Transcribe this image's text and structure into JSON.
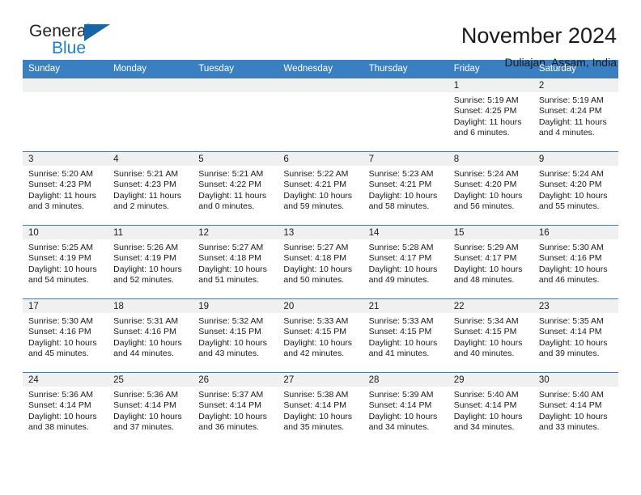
{
  "brand": {
    "name_part1": "General",
    "name_part2": "Blue"
  },
  "header": {
    "title": "November 2024",
    "subtitle": "Duliajan, Assam, India"
  },
  "colors": {
    "header_blue": "#3a7fc1",
    "logo_blue": "#1e7fc4",
    "date_band": "#f0f0f0"
  },
  "weekday_headers": [
    "Sunday",
    "Monday",
    "Tuesday",
    "Wednesday",
    "Thursday",
    "Friday",
    "Saturday"
  ],
  "labels": {
    "sunrise_prefix": "Sunrise:",
    "sunset_prefix": "Sunset:",
    "daylight_prefix": "Daylight:"
  },
  "weeks": [
    [
      {
        "empty": true
      },
      {
        "empty": true
      },
      {
        "empty": true
      },
      {
        "empty": true
      },
      {
        "empty": true
      },
      {
        "day": "1",
        "sunrise": "Sunrise: 5:19 AM",
        "sunset": "Sunset: 4:25 PM",
        "daylight_line1": "Daylight: 11 hours",
        "daylight_line2": "and 6 minutes."
      },
      {
        "day": "2",
        "sunrise": "Sunrise: 5:19 AM",
        "sunset": "Sunset: 4:24 PM",
        "daylight_line1": "Daylight: 11 hours",
        "daylight_line2": "and 4 minutes."
      }
    ],
    [
      {
        "day": "3",
        "sunrise": "Sunrise: 5:20 AM",
        "sunset": "Sunset: 4:23 PM",
        "daylight_line1": "Daylight: 11 hours",
        "daylight_line2": "and 3 minutes."
      },
      {
        "day": "4",
        "sunrise": "Sunrise: 5:21 AM",
        "sunset": "Sunset: 4:23 PM",
        "daylight_line1": "Daylight: 11 hours",
        "daylight_line2": "and 2 minutes."
      },
      {
        "day": "5",
        "sunrise": "Sunrise: 5:21 AM",
        "sunset": "Sunset: 4:22 PM",
        "daylight_line1": "Daylight: 11 hours",
        "daylight_line2": "and 0 minutes."
      },
      {
        "day": "6",
        "sunrise": "Sunrise: 5:22 AM",
        "sunset": "Sunset: 4:21 PM",
        "daylight_line1": "Daylight: 10 hours",
        "daylight_line2": "and 59 minutes."
      },
      {
        "day": "7",
        "sunrise": "Sunrise: 5:23 AM",
        "sunset": "Sunset: 4:21 PM",
        "daylight_line1": "Daylight: 10 hours",
        "daylight_line2": "and 58 minutes."
      },
      {
        "day": "8",
        "sunrise": "Sunrise: 5:24 AM",
        "sunset": "Sunset: 4:20 PM",
        "daylight_line1": "Daylight: 10 hours",
        "daylight_line2": "and 56 minutes."
      },
      {
        "day": "9",
        "sunrise": "Sunrise: 5:24 AM",
        "sunset": "Sunset: 4:20 PM",
        "daylight_line1": "Daylight: 10 hours",
        "daylight_line2": "and 55 minutes."
      }
    ],
    [
      {
        "day": "10",
        "sunrise": "Sunrise: 5:25 AM",
        "sunset": "Sunset: 4:19 PM",
        "daylight_line1": "Daylight: 10 hours",
        "daylight_line2": "and 54 minutes."
      },
      {
        "day": "11",
        "sunrise": "Sunrise: 5:26 AM",
        "sunset": "Sunset: 4:19 PM",
        "daylight_line1": "Daylight: 10 hours",
        "daylight_line2": "and 52 minutes."
      },
      {
        "day": "12",
        "sunrise": "Sunrise: 5:27 AM",
        "sunset": "Sunset: 4:18 PM",
        "daylight_line1": "Daylight: 10 hours",
        "daylight_line2": "and 51 minutes."
      },
      {
        "day": "13",
        "sunrise": "Sunrise: 5:27 AM",
        "sunset": "Sunset: 4:18 PM",
        "daylight_line1": "Daylight: 10 hours",
        "daylight_line2": "and 50 minutes."
      },
      {
        "day": "14",
        "sunrise": "Sunrise: 5:28 AM",
        "sunset": "Sunset: 4:17 PM",
        "daylight_line1": "Daylight: 10 hours",
        "daylight_line2": "and 49 minutes."
      },
      {
        "day": "15",
        "sunrise": "Sunrise: 5:29 AM",
        "sunset": "Sunset: 4:17 PM",
        "daylight_line1": "Daylight: 10 hours",
        "daylight_line2": "and 48 minutes."
      },
      {
        "day": "16",
        "sunrise": "Sunrise: 5:30 AM",
        "sunset": "Sunset: 4:16 PM",
        "daylight_line1": "Daylight: 10 hours",
        "daylight_line2": "and 46 minutes."
      }
    ],
    [
      {
        "day": "17",
        "sunrise": "Sunrise: 5:30 AM",
        "sunset": "Sunset: 4:16 PM",
        "daylight_line1": "Daylight: 10 hours",
        "daylight_line2": "and 45 minutes."
      },
      {
        "day": "18",
        "sunrise": "Sunrise: 5:31 AM",
        "sunset": "Sunset: 4:16 PM",
        "daylight_line1": "Daylight: 10 hours",
        "daylight_line2": "and 44 minutes."
      },
      {
        "day": "19",
        "sunrise": "Sunrise: 5:32 AM",
        "sunset": "Sunset: 4:15 PM",
        "daylight_line1": "Daylight: 10 hours",
        "daylight_line2": "and 43 minutes."
      },
      {
        "day": "20",
        "sunrise": "Sunrise: 5:33 AM",
        "sunset": "Sunset: 4:15 PM",
        "daylight_line1": "Daylight: 10 hours",
        "daylight_line2": "and 42 minutes."
      },
      {
        "day": "21",
        "sunrise": "Sunrise: 5:33 AM",
        "sunset": "Sunset: 4:15 PM",
        "daylight_line1": "Daylight: 10 hours",
        "daylight_line2": "and 41 minutes."
      },
      {
        "day": "22",
        "sunrise": "Sunrise: 5:34 AM",
        "sunset": "Sunset: 4:15 PM",
        "daylight_line1": "Daylight: 10 hours",
        "daylight_line2": "and 40 minutes."
      },
      {
        "day": "23",
        "sunrise": "Sunrise: 5:35 AM",
        "sunset": "Sunset: 4:14 PM",
        "daylight_line1": "Daylight: 10 hours",
        "daylight_line2": "and 39 minutes."
      }
    ],
    [
      {
        "day": "24",
        "sunrise": "Sunrise: 5:36 AM",
        "sunset": "Sunset: 4:14 PM",
        "daylight_line1": "Daylight: 10 hours",
        "daylight_line2": "and 38 minutes."
      },
      {
        "day": "25",
        "sunrise": "Sunrise: 5:36 AM",
        "sunset": "Sunset: 4:14 PM",
        "daylight_line1": "Daylight: 10 hours",
        "daylight_line2": "and 37 minutes."
      },
      {
        "day": "26",
        "sunrise": "Sunrise: 5:37 AM",
        "sunset": "Sunset: 4:14 PM",
        "daylight_line1": "Daylight: 10 hours",
        "daylight_line2": "and 36 minutes."
      },
      {
        "day": "27",
        "sunrise": "Sunrise: 5:38 AM",
        "sunset": "Sunset: 4:14 PM",
        "daylight_line1": "Daylight: 10 hours",
        "daylight_line2": "and 35 minutes."
      },
      {
        "day": "28",
        "sunrise": "Sunrise: 5:39 AM",
        "sunset": "Sunset: 4:14 PM",
        "daylight_line1": "Daylight: 10 hours",
        "daylight_line2": "and 34 minutes."
      },
      {
        "day": "29",
        "sunrise": "Sunrise: 5:40 AM",
        "sunset": "Sunset: 4:14 PM",
        "daylight_line1": "Daylight: 10 hours",
        "daylight_line2": "and 34 minutes."
      },
      {
        "day": "30",
        "sunrise": "Sunrise: 5:40 AM",
        "sunset": "Sunset: 4:14 PM",
        "daylight_line1": "Daylight: 10 hours",
        "daylight_line2": "and 33 minutes."
      }
    ]
  ]
}
